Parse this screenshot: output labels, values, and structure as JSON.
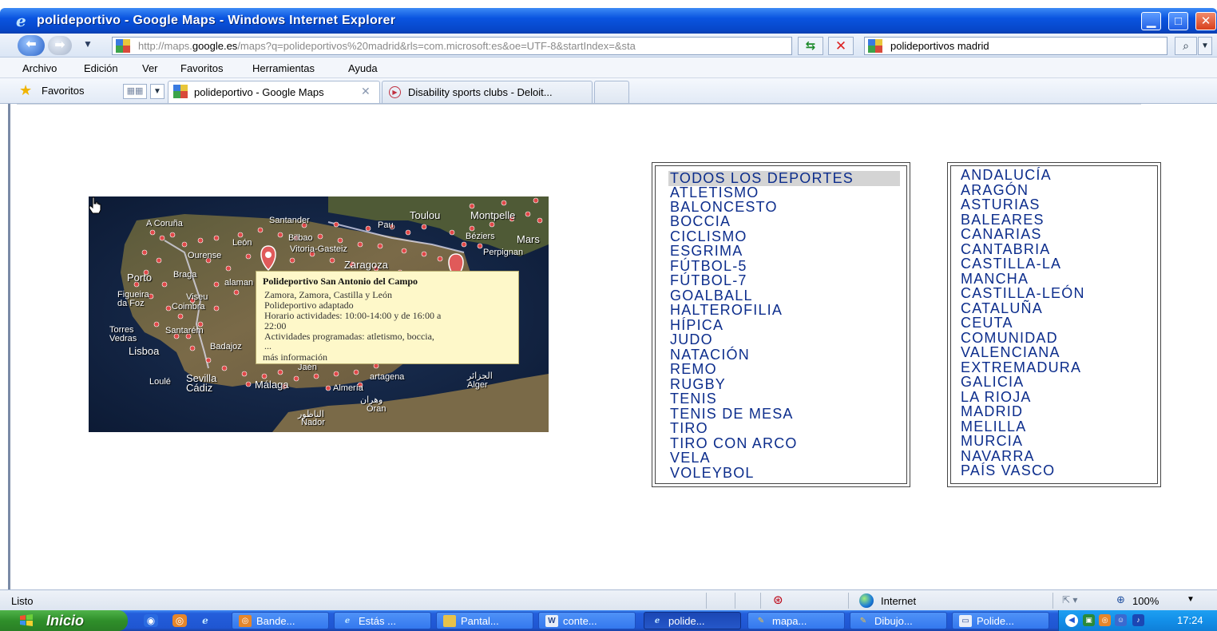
{
  "window": {
    "title": "polideportivo - Google Maps - Windows Internet Explorer",
    "min_label": "▁",
    "max_label": "□",
    "close_label": "✕"
  },
  "addressbar": {
    "url_prefix": "http://maps.",
    "url_domain": "google.es",
    "url_rest": "/maps?q=polideportivos%20madrid&rls=com.microsoft:es&oe=UTF-8&startIndex=&sta",
    "search_value": "polideportivos madrid"
  },
  "menu": {
    "items": [
      "Archivo",
      "Edición",
      "Ver",
      "Favoritos",
      "Herramientas",
      "Ayuda"
    ]
  },
  "favorites": {
    "label": "Favoritos"
  },
  "tabs": [
    {
      "label": "polideportivo - Google Maps"
    },
    {
      "label": "Disability sports clubs - Deloit..."
    }
  ],
  "map": {
    "labels": {
      "acoruna": "A Coruña",
      "santander": "Santander",
      "pau": "Pau",
      "toulouse": "Toulou",
      "montpellier": "Montpelle",
      "leon": "León",
      "bilbao": "Bilbao",
      "vitoria": "Vitoria-Gasteiz",
      "beziers": "Béziers",
      "marseille": "Mars",
      "ourense": "Ourense",
      "perpignan": "Perpignan",
      "zaragoza": "Zaragoza",
      "porto": "Porto",
      "braga": "Braga",
      "salamanca": "alaman",
      "figueira": "Figueira\nda Foz",
      "viseu": "Viseu",
      "coimbra": "Coimbra",
      "torres": "Torres\nVedras",
      "santarem": "Santarém",
      "lisboa": "Lisboa",
      "badajoz": "Badajoz",
      "loule": "Loulé",
      "sevilla": "Sevilla",
      "cadiz": "Cádiz",
      "malaga": "Málaga",
      "jaen": "Jaén",
      "almeria": "Almería",
      "cartagena": "artagena",
      "oran_ar": "وهران",
      "oran": "Oran",
      "nador_ar": "الناظور",
      "nador": "Nador",
      "alger_ar": "الجزائر",
      "alger": "Alger"
    },
    "infowindow": {
      "title": "Polideportivo San Antonio del Campo",
      "lines": [
        "Zamora, Zamora, Castilla y León",
        "Polideportivo adaptado",
        "Horario actividades: 10:00-14:00 y de 16:00 a",
        "22:00",
        "Actividades programadas: atletismo, boccia,",
        "..."
      ],
      "more_link": "más información"
    }
  },
  "sports": [
    "TODOS LOS DEPORTES",
    "ATLETISMO",
    "BALONCESTO",
    "BOCCIA",
    "CICLISMO",
    "ESGRIMA",
    "FÚTBOL-5",
    "FÚTBOL-7",
    "GOALBALL",
    "HALTEROFILIA",
    "HÍPICA",
    "JUDO",
    "NATACIÓN",
    "REMO",
    "RUGBY",
    "TENIS",
    "TENIS DE MESA",
    "TIRO",
    "TIRO CON ARCO",
    "VELA",
    "VOLEYBOL"
  ],
  "regions": [
    "ANDALUCÍA",
    "ARAGÓN",
    "ASTURIAS",
    "BALEARES",
    "CANARIAS",
    "CANTABRIA",
    "CASTILLA-LA",
    "MANCHA",
    "CASTILLA-LEÓN",
    "CATALUÑA",
    "CEUTA",
    "COMUNIDAD",
    "VALENCIANA",
    "EXTREMADURA",
    "GALICIA",
    "LA RIOJA",
    "MADRID",
    "MELILLA",
    "MURCIA",
    "NAVARRA",
    "PAÍS VASCO"
  ],
  "statusbar": {
    "text": "Listo",
    "zone": "Internet",
    "zoom": "100%"
  },
  "taskbar": {
    "start": "Inicio",
    "tasks": [
      {
        "label": "Bande..."
      },
      {
        "label": "Estás ..."
      },
      {
        "label": "Pantal..."
      },
      {
        "label": "conte..."
      },
      {
        "label": "polide..."
      },
      {
        "label": "mapa..."
      },
      {
        "label": "Dibujo..."
      },
      {
        "label": "Polide..."
      }
    ],
    "clock": "17:24"
  },
  "colors": {
    "list_text": "#0c2d8c",
    "titlebar": "#0a54e0",
    "infowindow_bg": "#fef8c9"
  }
}
